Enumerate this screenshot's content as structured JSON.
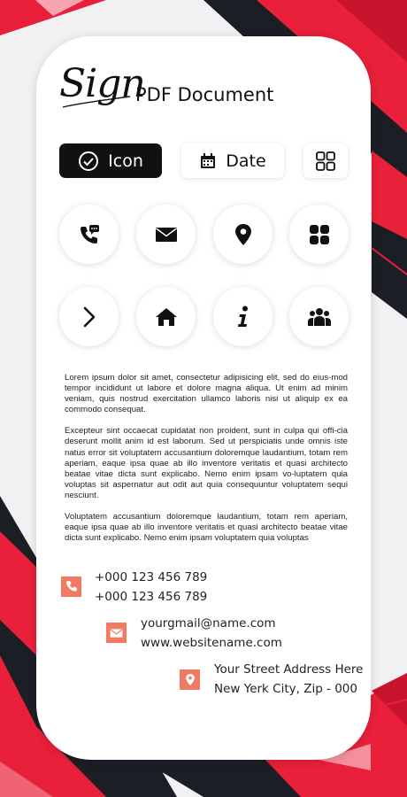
{
  "header": {
    "sign_script": "Sign",
    "doc_title": "PDF Document"
  },
  "tabs": {
    "icon_label": "Icon",
    "date_label": "Date"
  },
  "icons": [
    "phone-chat-icon",
    "envelope-icon",
    "location-pin-icon",
    "grid-tiles-icon",
    "chevron-right-icon",
    "home-icon",
    "info-icon",
    "group-icon"
  ],
  "body": {
    "p1": "Lorem ipsum dolor sit amet, consectetur adipisicing elit, sed do eius-mod tempor incididunt ut labore et dolore magna aliqua. Ut enim ad minim veniam, quis nostrud exercitation ullamco laboris nisi ut aliquip ex ea commodo consequat.",
    "p2": "Excepteur sint occaecat cupidatat non proident, sunt in culpa qui offi-cia deserunt mollit anim id est laborum. Sed ut perspiciatis unde omnis iste natus error sit voluptatem accusantium doloremque laudantium, totam rem aperiam, eaque ipsa quae ab illo inventore veritatis et quasi architecto beatae vitae dicta sunt explicabo. Nemo enim ipsam vo-luptatem quia voluptas sit aspernatur aut odit aut quia consequuntur voluptatem sequi nesciunt.",
    "p3": "Voluptatem accusantium doloremque laudantium, totam rem aperiam, eaque ipsa quae ab illo inventore veritatis et quasi architecto beatae vitae dicta sunt explicabo. Nemo enim ipsam voluptatem quia voluptas"
  },
  "contact": {
    "phone1": "+000 123 456 789",
    "phone2": "+000 123 456 789",
    "email": "yourgmail@name.com",
    "website": "www.websitename.com",
    "address1": "Your Street Address Here",
    "address2": "New Yerk City, Zip - 000"
  },
  "colors": {
    "accent_red": "#e8203a",
    "dark": "#1b1d24",
    "contact_icon": "#f07a62"
  }
}
